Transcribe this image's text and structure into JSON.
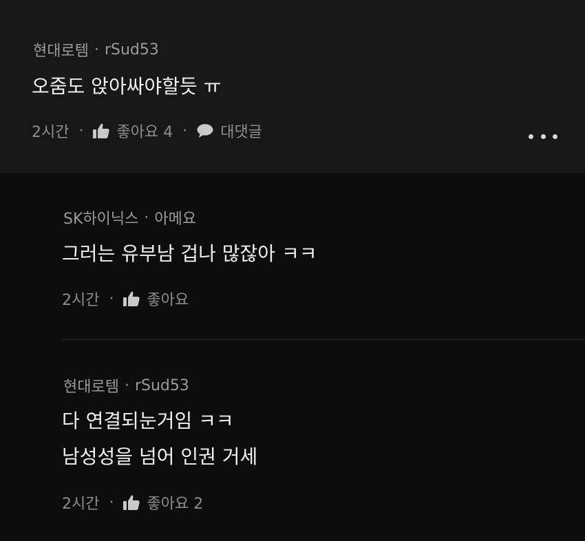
{
  "comments": [
    {
      "company": "현대로템",
      "username": "rSud53",
      "lines": [
        "오줌도 앉아싸야할듯 ㅠ"
      ],
      "time": "2시간",
      "like_label": "좋아요 4",
      "reply_label": "대댓글"
    }
  ],
  "replies": [
    {
      "company": "SK하이닉스",
      "username": "아메요",
      "lines": [
        "그러는 유부남 겁나 많잖아 ㅋㅋ"
      ],
      "time": "2시간",
      "like_label": "좋아요"
    },
    {
      "company": "현대로템",
      "username": "rSud53",
      "lines": [
        "다 연결되눈거임 ㅋㅋ",
        "남성성을 넘어 인권 거세"
      ],
      "time": "2시간",
      "like_label": "좋아요 2"
    }
  ],
  "separator": "·",
  "icons": {
    "like": "thumbs-up-icon",
    "reply": "speech-bubble-icon",
    "more": "more-horizontal-icon"
  },
  "colors": {
    "top_background": "#171717",
    "reply_background": "#0d0d0d",
    "meta_text": "#9b9b9b",
    "body_text": "#f0f0f0"
  }
}
